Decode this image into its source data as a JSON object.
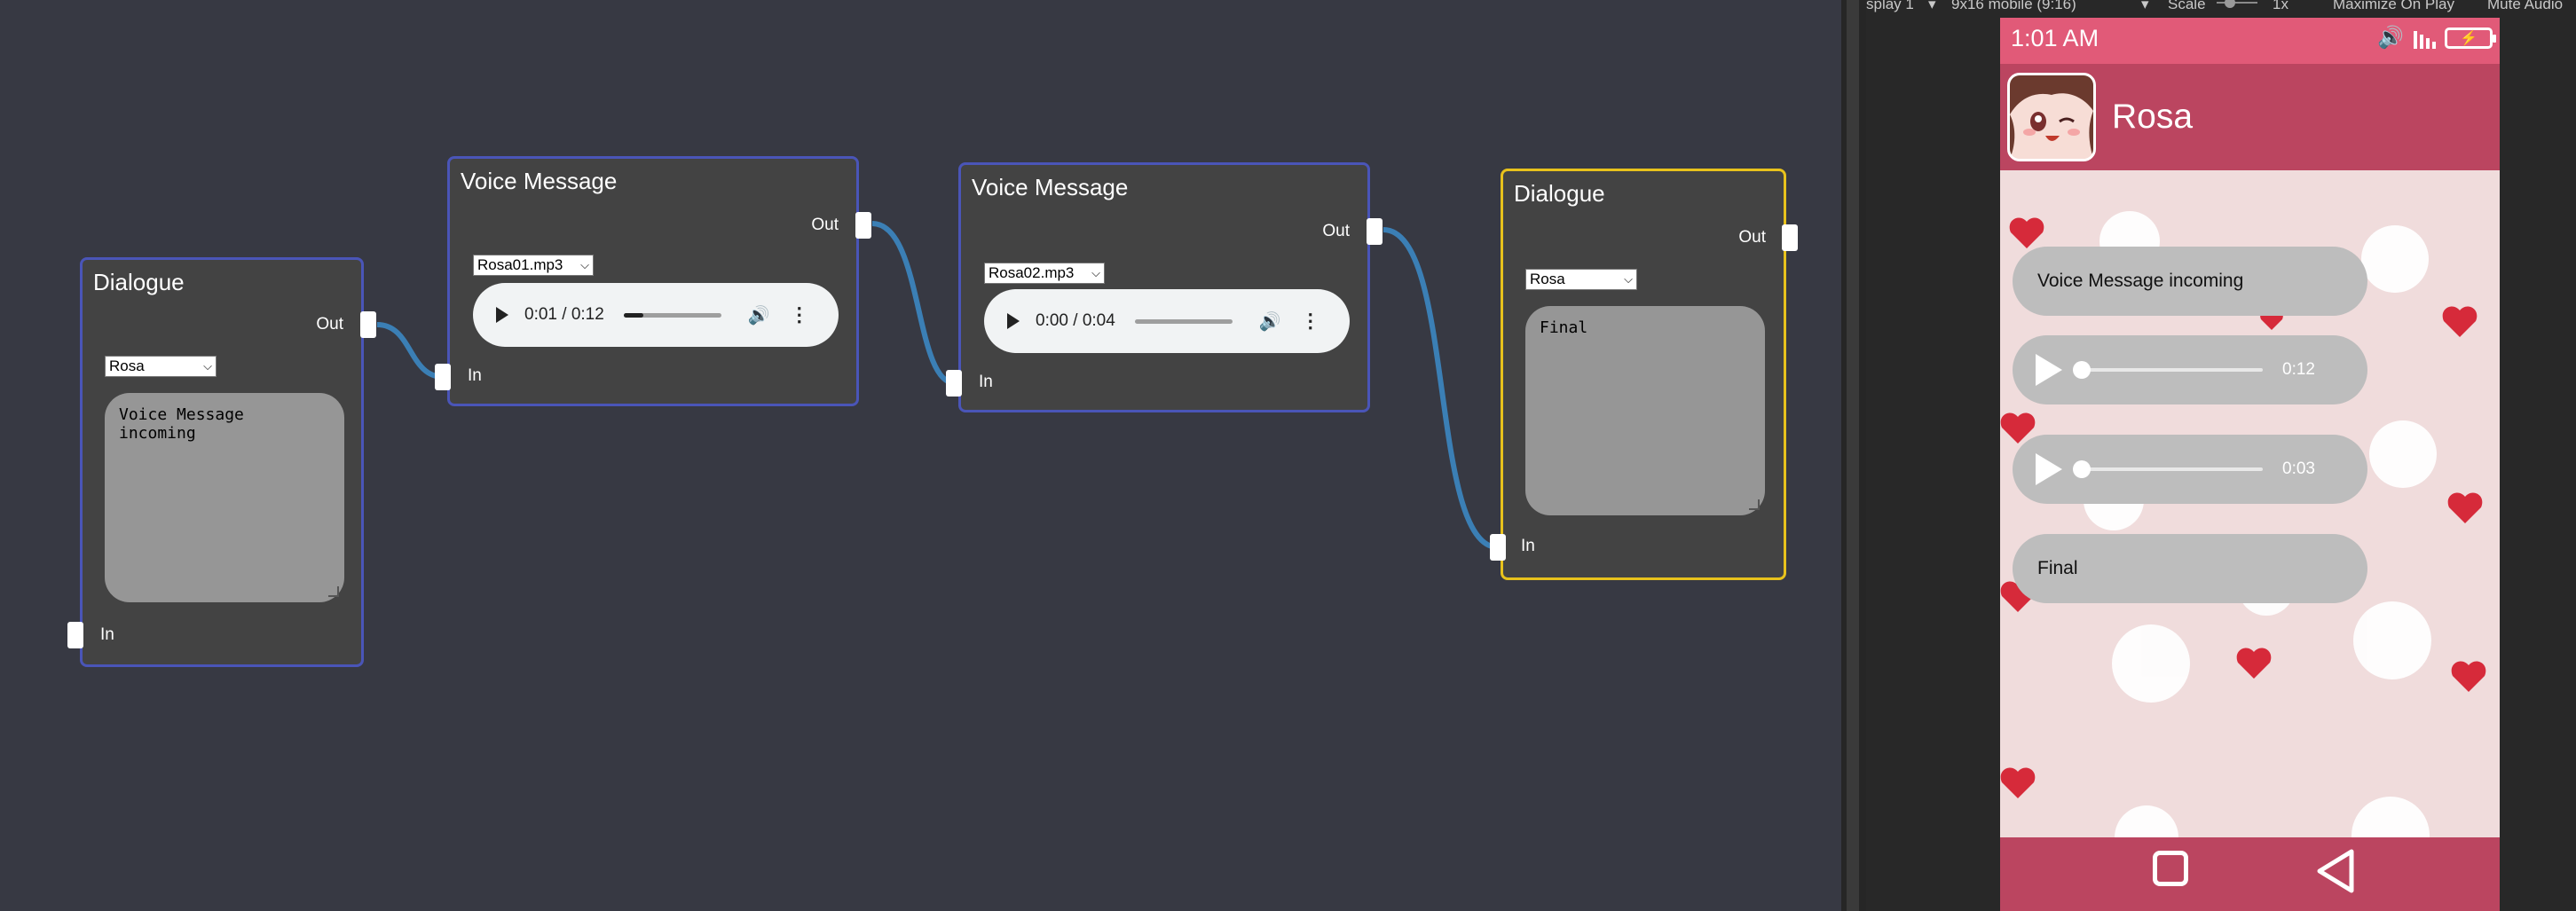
{
  "graph": {
    "nodes": [
      {
        "title": "Dialogue",
        "out_label": "Out",
        "in_label": "In",
        "character": "Rosa",
        "text": "Voice Message incoming"
      },
      {
        "title": "Voice Message",
        "out_label": "Out",
        "in_label": "In",
        "file": "Rosa01.mp3",
        "time": "0:01 / 0:12",
        "progress": 0.08
      },
      {
        "title": "Voice Message",
        "out_label": "Out",
        "in_label": "In",
        "file": "Rosa02.mp3",
        "time": "0:00 / 0:04",
        "progress": 0.0
      },
      {
        "title": "Dialogue",
        "out_label": "Out",
        "in_label": "In",
        "character": "Rosa",
        "text": "Final"
      }
    ],
    "colors": {
      "canvas": "#373943",
      "node": "#434343",
      "node_border": "#4a55b8",
      "selected_border": "#e8c21c",
      "wire": "#3b7fb5"
    }
  },
  "game_view": {
    "toolbar": {
      "display": "splay 1",
      "aspect": "9x16 mobile (9:16)",
      "scale_label": "Scale",
      "scale_value": "1x",
      "maximize": "Maximize On Play",
      "mute": "Mute Audio"
    },
    "phone": {
      "clock": "1:01 AM",
      "contact_name": "Rosa",
      "messages": [
        {
          "type": "text",
          "text": "Voice Message incoming"
        },
        {
          "type": "audio",
          "duration": "0:12"
        },
        {
          "type": "audio",
          "duration": "0:03"
        },
        {
          "type": "text",
          "text": "Final"
        }
      ],
      "icons": {
        "volume": "volume-icon",
        "signal": "signal-icon",
        "battery": "battery-charging-icon",
        "home": "square-home-icon",
        "back": "triangle-back-icon"
      },
      "colors": {
        "status_bar": "#e15a78",
        "header": "#bb4560",
        "background": "#f0dcdc",
        "bubble": "#bdbdbd"
      }
    }
  }
}
